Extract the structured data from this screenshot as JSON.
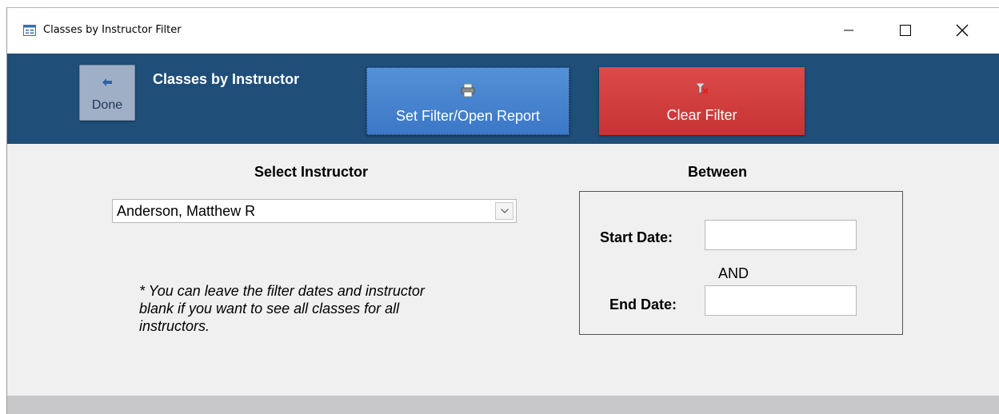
{
  "window": {
    "title": "Classes by Instructor Filter",
    "controls": [
      "minimize",
      "maximize",
      "close"
    ]
  },
  "header": {
    "form_title": "Classes by Instructor",
    "done_label": "Done",
    "set_filter_label": "Set Filter/Open Report",
    "clear_filter_label": "Clear Filter",
    "colors": {
      "background": "#1f4e79",
      "set_filter": "#3b77c6",
      "clear_filter": "#c63333",
      "done": "#9fb0c6"
    }
  },
  "instructor": {
    "heading": "Select Instructor",
    "selected": "Anderson, Matthew R"
  },
  "dates": {
    "heading": "Between",
    "start_label": "Start Date:",
    "start_value": "",
    "and_label": "AND",
    "end_label": "End Date:",
    "end_value": ""
  },
  "note": "* You can leave the filter dates and instructor blank if you want to see all classes for all instructors."
}
